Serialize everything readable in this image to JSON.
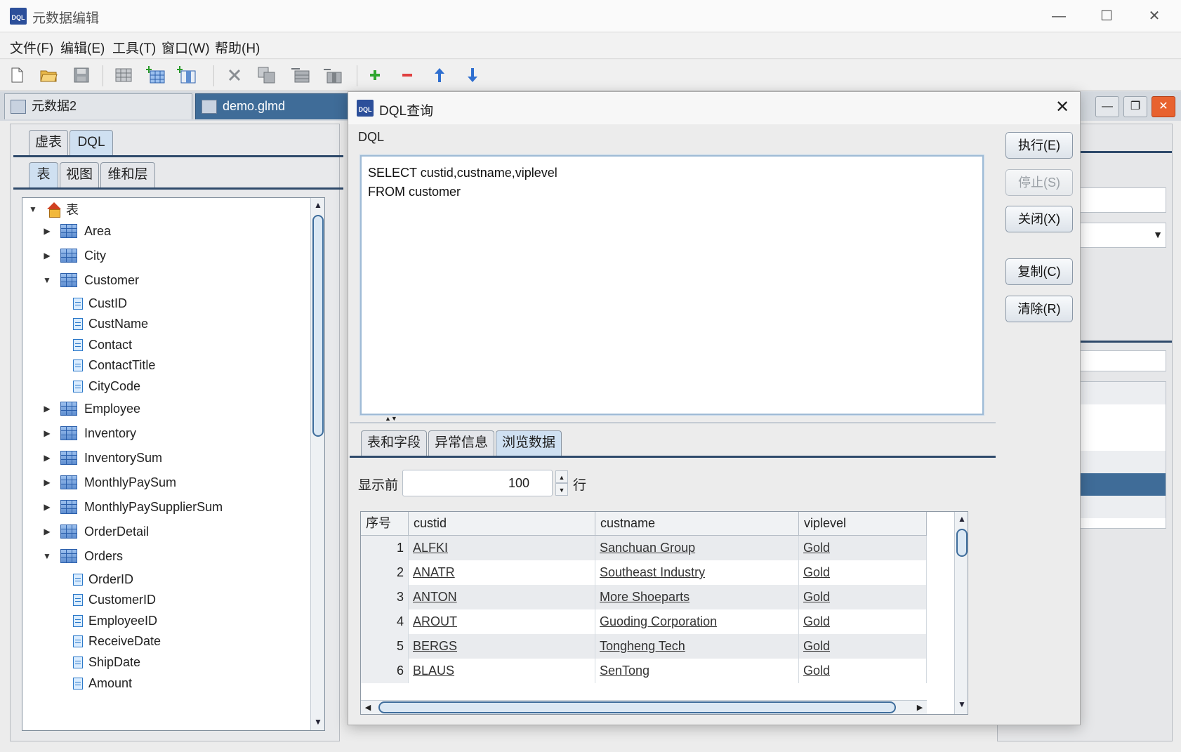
{
  "window": {
    "title": "元数据编辑",
    "icon_text": "DQL",
    "minimize": "—",
    "maximize": "☐",
    "close": "✕"
  },
  "menu": [
    "文件(F)",
    "编辑(E)",
    "工具(T)",
    "窗口(W)",
    "帮助(H)"
  ],
  "toolbar": {
    "icons": [
      "new-file-icon",
      "open-folder-icon",
      "save-icon",
      "table-icon",
      "add-table-icon",
      "add-field-icon",
      "delete-icon",
      "copy-icon",
      "move-table-icon",
      "move-field-icon",
      "add-icon",
      "remove-icon",
      "move-up-icon",
      "move-down-icon"
    ]
  },
  "doc_tabs": [
    {
      "label": "元数据2",
      "active": false
    },
    {
      "label": "demo.glmd",
      "active": true
    }
  ],
  "mdi_buttons": [
    "—",
    "❐",
    "✕"
  ],
  "left_panel": {
    "top_tabs": [
      "虚表",
      "DQL"
    ],
    "sub_tabs": [
      "表",
      "视图",
      "维和层"
    ],
    "tree": {
      "root": "表",
      "nodes": [
        {
          "label": "Area",
          "type": "table",
          "expanded": false
        },
        {
          "label": "City",
          "type": "table",
          "expanded": false
        },
        {
          "label": "Customer",
          "type": "table",
          "expanded": true
        },
        {
          "label": "CustID",
          "type": "field"
        },
        {
          "label": "CustName",
          "type": "field"
        },
        {
          "label": "Contact",
          "type": "field"
        },
        {
          "label": "ContactTitle",
          "type": "field"
        },
        {
          "label": "CityCode",
          "type": "field"
        },
        {
          "label": "Employee",
          "type": "table",
          "expanded": false
        },
        {
          "label": "Inventory",
          "type": "table",
          "expanded": false
        },
        {
          "label": "InventorySum",
          "type": "table",
          "expanded": false
        },
        {
          "label": "MonthlyPaySum",
          "type": "table",
          "expanded": false
        },
        {
          "label": "MonthlyPaySupplierSum",
          "type": "table",
          "expanded": false
        },
        {
          "label": "OrderDetail",
          "type": "table",
          "expanded": false
        },
        {
          "label": "Orders",
          "type": "table",
          "expanded": true
        },
        {
          "label": "OrderID",
          "type": "field"
        },
        {
          "label": "CustomerID",
          "type": "field"
        },
        {
          "label": "EmployeeID",
          "type": "field"
        },
        {
          "label": "ReceiveDate",
          "type": "field"
        },
        {
          "label": "ShipDate",
          "type": "field"
        },
        {
          "label": "Amount",
          "type": "field"
        }
      ]
    }
  },
  "dialog": {
    "title": "DQL查询",
    "icon_text": "DQL",
    "close": "✕",
    "dql_label": "DQL",
    "query": "SELECT custid,custname,viplevel\nFROM customer",
    "buttons": [
      {
        "label": "执行(E)",
        "enabled": true
      },
      {
        "label": "停止(S)",
        "enabled": false
      },
      {
        "label": "关闭(X)",
        "enabled": true
      },
      {
        "label": "复制(C)",
        "enabled": true
      },
      {
        "label": "清除(R)",
        "enabled": true
      }
    ],
    "result_tabs": [
      "表和字段",
      "异常信息",
      "浏览数据"
    ],
    "active_result_tab": "浏览数据",
    "show_prefix": "显示前",
    "row_limit": "100",
    "row_suffix": "行",
    "grid": {
      "columns": [
        "序号",
        "custid",
        "custname",
        "viplevel"
      ],
      "rows": [
        [
          "1",
          "ALFKI",
          "Sanchuan Group",
          "Gold"
        ],
        [
          "2",
          "ANATR",
          "Southeast Industry",
          "Gold"
        ],
        [
          "3",
          "ANTON",
          "More Shoeparts",
          "Gold"
        ],
        [
          "4",
          "AROUT",
          "Guoding Corporation",
          "Gold"
        ],
        [
          "5",
          "BERGS",
          "Tongheng Tech",
          "Gold"
        ],
        [
          "6",
          "BLAUS",
          "SenTong",
          "Gold"
        ]
      ]
    }
  }
}
